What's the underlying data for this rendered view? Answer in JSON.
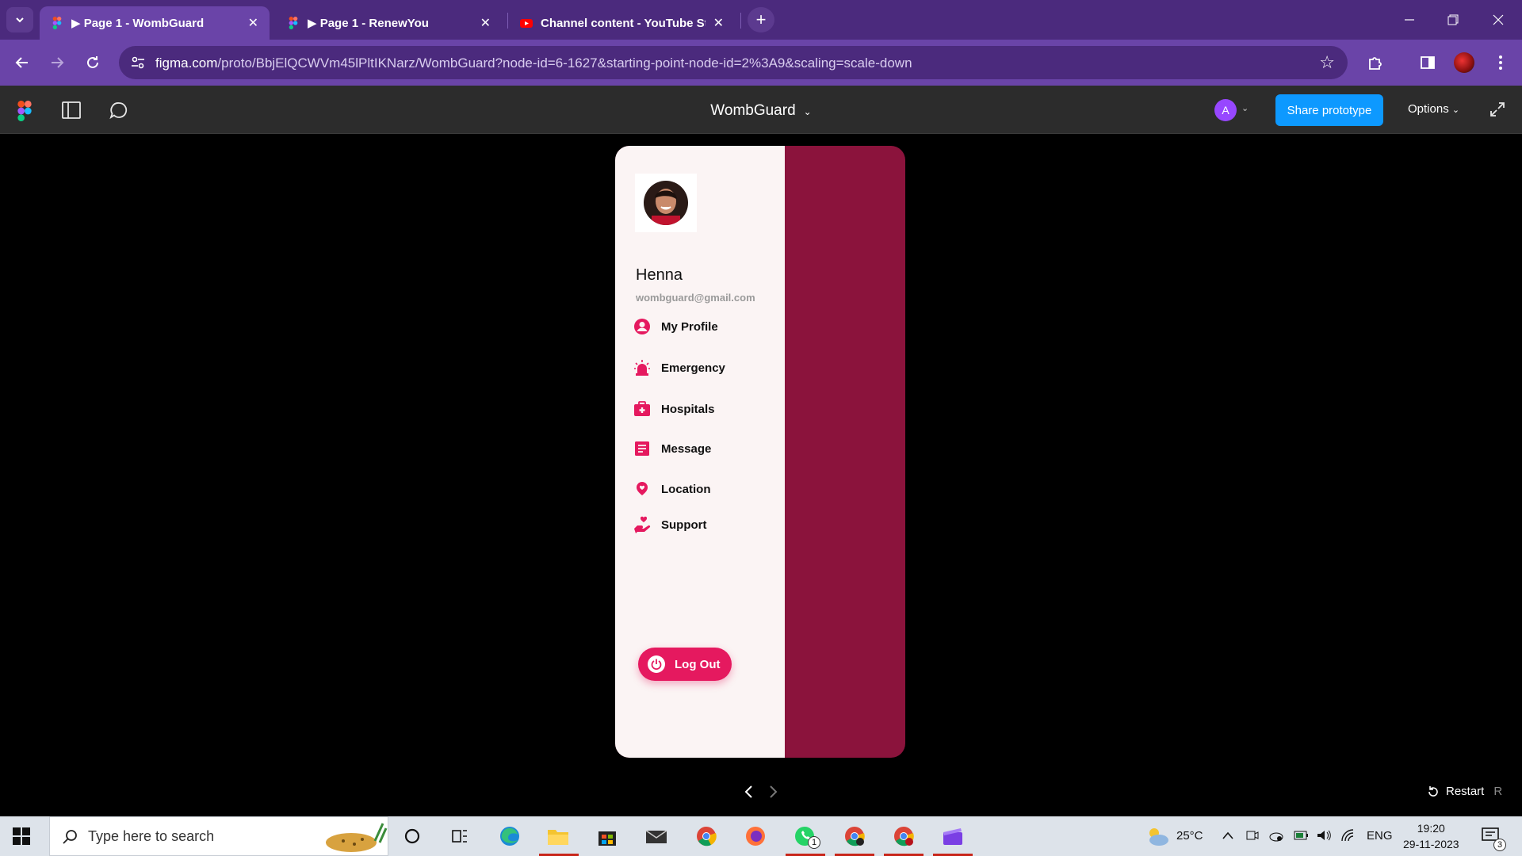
{
  "browser": {
    "tabs": [
      {
        "title": "▶ Page 1 - WombGuard",
        "favicon": "figma-icon",
        "active": true
      },
      {
        "title": "▶ Page 1 - RenewYou",
        "favicon": "figma-icon",
        "active": false
      },
      {
        "title": "Channel content - YouTube Studio",
        "favicon": "youtube-icon",
        "active": false
      }
    ],
    "url_domain": "figma.com",
    "url_rest": "/proto/BbjElQCWVm45lPltIKNarz/WombGuard?node-id=6-1627&starting-point-node-id=2%3A9&scaling=scale-down"
  },
  "figma": {
    "file_title": "WombGuard",
    "avatar_initial": "A",
    "share_label": "Share prototype",
    "options_label": "Options",
    "restart_label": "Restart",
    "restart_key": "R"
  },
  "app": {
    "user": {
      "name": "Henna",
      "email": "wombguard@gmail.com"
    },
    "menu": [
      {
        "label": "My Profile",
        "icon": "profile-icon"
      },
      {
        "label": "Emergency",
        "icon": "siren-icon"
      },
      {
        "label": "Hospitals",
        "icon": "medical-kit-icon"
      },
      {
        "label": "Message",
        "icon": "message-icon"
      },
      {
        "label": "Location",
        "icon": "location-pin-icon"
      },
      {
        "label": "Support",
        "icon": "support-hand-icon"
      }
    ],
    "logout_label": "Log Out",
    "colors": {
      "accent": "#e5195f",
      "panel": "#8b133c",
      "drawer": "#fbf4f4"
    }
  },
  "taskbar": {
    "search_placeholder": "Type here to search",
    "temperature": "25°C",
    "language": "ENG",
    "time": "19:20",
    "date": "29-11-2023",
    "whatsapp_badge": "1",
    "notification_badge": "3"
  }
}
